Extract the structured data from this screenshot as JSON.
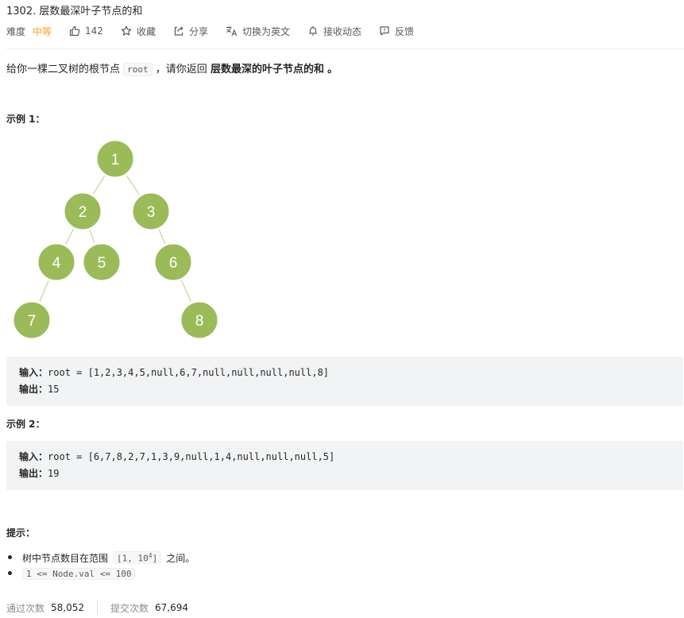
{
  "header": {
    "title": "1302. 层数最深叶子节点的和",
    "difficulty_label": "难度",
    "difficulty": "中等",
    "likes": "142",
    "favorite": "收藏",
    "share": "分享",
    "translate": "切换为英文",
    "notify": "接收动态",
    "feedback": "反馈"
  },
  "description": {
    "prefix": "给你一棵二叉树的根节点",
    "code": "root",
    "middle": "，请你返回",
    "bold": "层数最深的叶子节点的和",
    "suffix": "。"
  },
  "examples": [
    {
      "title": "示例 1：",
      "input_label": "输入：",
      "input": "root = [1,2,3,4,5,null,6,7,null,null,null,null,8]",
      "output_label": "输出：",
      "output": "15"
    },
    {
      "title": "示例 2：",
      "input_label": "输入：",
      "input": "root = [6,7,8,2,7,1,3,9,null,1,4,null,null,null,5]",
      "output_label": "输出：",
      "output": "19"
    }
  ],
  "tree": {
    "node_color": "#9bbb59",
    "nodes": [
      "1",
      "2",
      "3",
      "4",
      "5",
      "6",
      "7",
      "8"
    ]
  },
  "hints": {
    "title": "提示：",
    "item1_prefix": "树中节点数目在范围",
    "item1_code": "[1, 10",
    "item1_sup": "4",
    "item1_code_end": "]",
    "item1_suffix": "之间。",
    "item2_code": "1 <= Node.val <= 100"
  },
  "stats": {
    "accepted_label": "通过次数",
    "accepted": "58,052",
    "submitted_label": "提交次数",
    "submitted": "67,694"
  },
  "colors": {
    "difficulty_medium": "#ffa116",
    "code_block_bg": "#f2f3f4"
  }
}
